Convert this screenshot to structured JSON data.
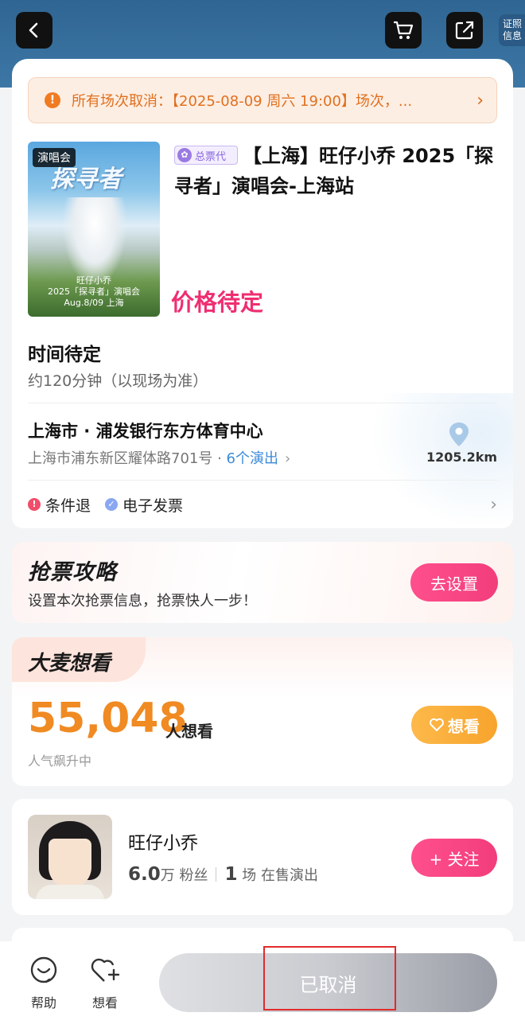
{
  "header": {
    "cert_label": "证照信息"
  },
  "notice": {
    "text": "所有场次取消：【2025-08-09  周六 19:00】场次，..."
  },
  "poster": {
    "tag": "演唱会",
    "art_title": "探寻者",
    "caption_name": "旺仔小乔",
    "caption_sub": "2025「探寻者」演唱会",
    "caption_date": "Aug.8/09 上海"
  },
  "event": {
    "badge": "总票代",
    "title": "【上海】旺仔小乔 2025「探寻者」演唱会-上海站",
    "price": "价格待定",
    "time_title": "时间待定",
    "duration": "约120分钟（以现场为准）",
    "venue_name": "上海市 · 浦发银行东方体育中心",
    "venue_address": "上海市浦东新区耀体路701号 · ",
    "venue_shows": "6个演出",
    "distance": "1205.2km",
    "cond_refund": "条件退",
    "cond_invoice": "电子发票"
  },
  "grab": {
    "title": "抢票攻略",
    "subtitle": "设置本次抢票信息，抢票快人一步！",
    "button": "去设置"
  },
  "want": {
    "tag": "大麦想看",
    "count": "55,048",
    "unit": "人想看",
    "trend": "人气飙升中",
    "button": "想看"
  },
  "artist": {
    "name": "旺仔小乔",
    "fans_value": "6.0",
    "fans_unit": "万 粉丝",
    "shows_value": "1",
    "shows_unit": "场 在售演出",
    "follow": "+ 关注"
  },
  "bottom": {
    "help": "帮助",
    "want": "想看",
    "status_button": "已取消"
  },
  "colors": {
    "accent_pink": "#ef2e71",
    "notice_orange": "#e0701f",
    "want_orange": "#f08a22",
    "link_blue": "#3d8ad8"
  }
}
